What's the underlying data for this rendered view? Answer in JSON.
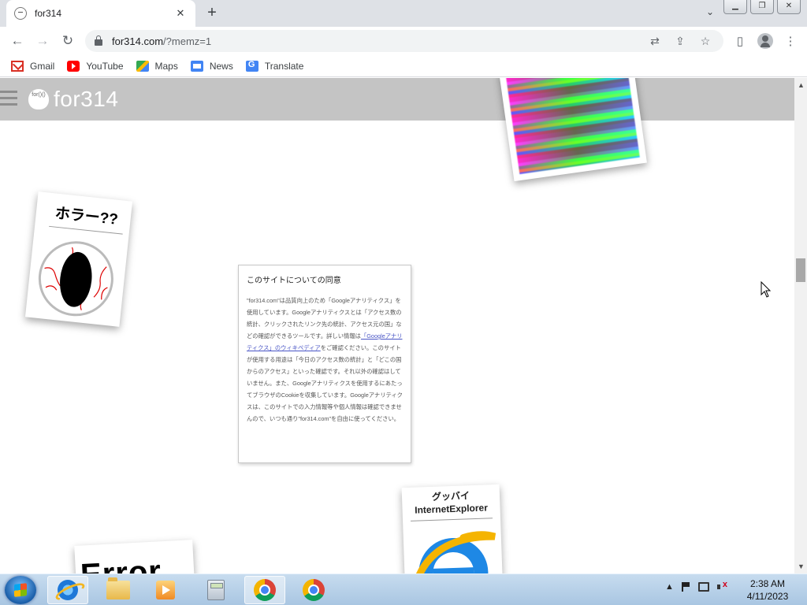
{
  "browser": {
    "tab": {
      "title": "for314",
      "close": "✕"
    },
    "new_tab": "+",
    "tab_dropdown": "⌄",
    "window_buttons": {
      "minimize": "▁",
      "restore": "❐",
      "close": "✕"
    },
    "nav": {
      "back": "←",
      "forward": "→",
      "reload": "↻"
    },
    "url": {
      "host": "for314.com",
      "path": "/?memz=1"
    },
    "omnibox_icons": [
      "translate-icon",
      "share-icon",
      "bookmark-star-icon"
    ],
    "toolbar_icons": [
      "side-panel-icon",
      "profile-icon",
      "menu-icon"
    ],
    "bookmarks": [
      {
        "label": "Gmail",
        "icon": "gmail-icon"
      },
      {
        "label": "YouTube",
        "icon": "youtube-icon"
      },
      {
        "label": "Maps",
        "icon": "maps-icon"
      },
      {
        "label": "News",
        "icon": "news-icon"
      },
      {
        "label": "Translate",
        "icon": "translate-icon"
      }
    ]
  },
  "site": {
    "logo_icon_text": "for()()",
    "logo_text": "for314",
    "cards": {
      "horror_title": "ホラー??",
      "ie_title_line1": "グッバイ",
      "ie_title_line2": "InternetExplorer",
      "error_text": "Error"
    },
    "consent": {
      "title": "このサイトについての同意",
      "body_before_link": "\"for314.com\"は品質向上のため「Googleアナリティクス」を使用しています。Googleアナリティクスとは「アクセス数の統計、クリックされたリンク先の統計、アクセス元の国」などの確認ができるツールです。詳しい情報は",
      "link_text": "「Googleアナリティクス」のウィキペディア",
      "body_after_link": "をご確認ください。このサイトが使用する用途は「今日のアクセス数の統計」と「どこの国からのアクセス」といった確認です。それ以外の確認はしていません。また、Googleアナリティクスを使用するにあたってブラウザのCookieを収集しています。Googleアナリティクスは、このサイトでの入力情報等や個人情報は確認できませんので、いつも通り\"for314.com\"を自由に使ってください。"
    }
  },
  "taskbar": {
    "apps": [
      "internet-explorer-icon",
      "file-explorer-icon",
      "media-player-icon",
      "calculator-icon",
      "chrome-icon",
      "chrome-icon"
    ],
    "tray_arrow": "▲",
    "clock_time": "2:38 AM",
    "clock_date": "4/11/2023"
  },
  "colors": {
    "site_header": "#c4c4c4",
    "link": "#4a56c6",
    "taskbar": "#b5cfe8"
  }
}
